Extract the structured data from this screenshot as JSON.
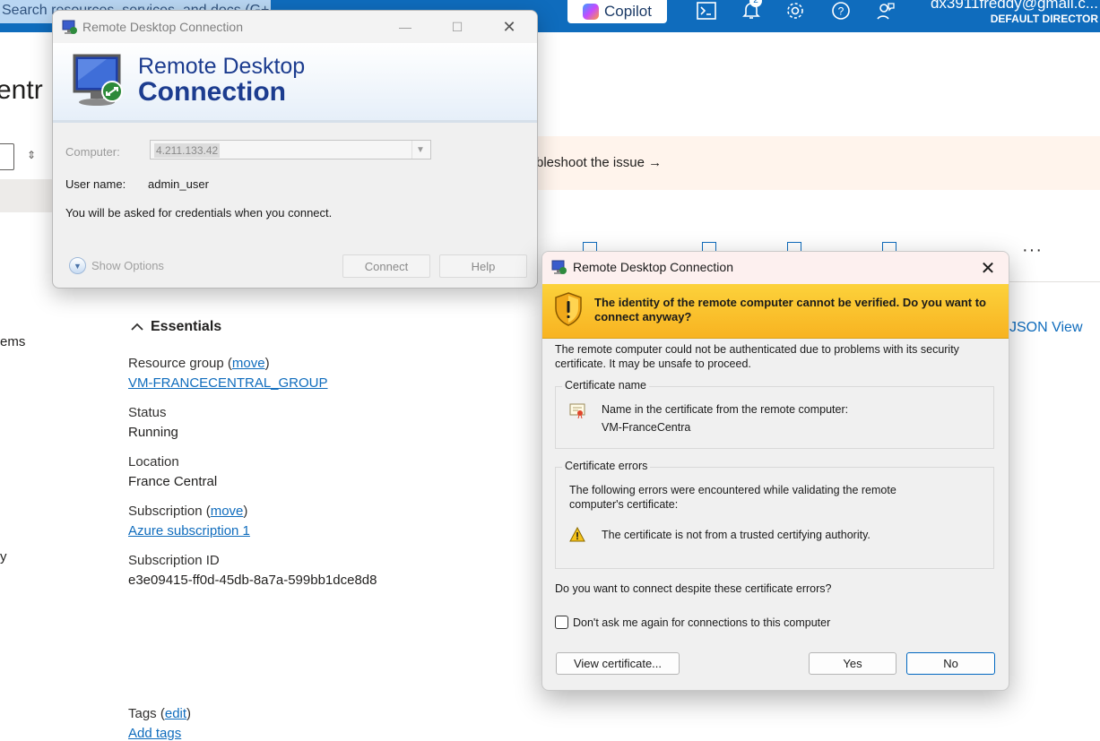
{
  "portal": {
    "search_placeholder": "Search resources, services, and docs (G+/)",
    "copilot_label": "Copilot",
    "notifications_count": "2",
    "user_email": "dx3911freddy@gmail.c...",
    "user_directory": "DEFAULT DIRECTOR",
    "page_title_fragment": "entr",
    "banner_text": "bleshoot the issue →",
    "json_view_label": "JSON View",
    "more_label": "···",
    "left_fragments": [
      "ems",
      "y"
    ],
    "essentials": {
      "title": "Essentials",
      "resource_group": {
        "label": "Resource group",
        "move": "move",
        "value": "VM-FRANCECENTRAL_GROUP"
      },
      "status": {
        "label": "Status",
        "value": "Running"
      },
      "location": {
        "label": "Location",
        "value": "France Central"
      },
      "subscription": {
        "label": "Subscription",
        "move": "move",
        "value": "Azure subscription 1"
      },
      "subscription_id": {
        "label": "Subscription ID",
        "value": "e3e09415-ff0d-45db-8a7a-599bb1dce8d8"
      },
      "tags": {
        "label": "Tags",
        "edit": "edit",
        "add": "Add tags"
      }
    }
  },
  "rdc_window": {
    "title": "Remote Desktop Connection",
    "header_line1": "Remote Desktop",
    "header_line2": "Connection",
    "computer_label": "Computer:",
    "computer_value": "4.211.133.42",
    "username_label": "User name:",
    "username_value": "admin_user",
    "credentials_note": "You will be asked for credentials when you connect.",
    "show_options": "Show Options",
    "connect_button": "Connect",
    "help_button": "Help"
  },
  "cert_dialog": {
    "title": "Remote Desktop Connection",
    "warning_header": "The identity of the remote computer cannot be verified. Do you want to connect anyway?",
    "intro": "The remote computer could not be authenticated due to problems with its security certificate. It may be unsafe to proceed.",
    "cert_name_group": "Certificate name",
    "cert_name_line1": "Name in the certificate from the remote computer:",
    "cert_name_value": "VM-FranceCentra",
    "cert_errors_group": "Certificate errors",
    "cert_errors_intro": "The following errors were encountered while validating the remote computer's certificate:",
    "cert_error_item": "The certificate is not from a trusted certifying authority.",
    "question": "Do you want to connect despite these certificate errors?",
    "dont_ask_label": "Don't ask me again for connections to this computer",
    "dont_ask_checked": false,
    "view_cert_button": "View certificate...",
    "yes_button": "Yes",
    "no_button": "No"
  },
  "colors": {
    "azure_blue": "#0f6cbd",
    "warning_yellow": "#fcd23b",
    "rdc_blue": "#1c3c8f"
  }
}
